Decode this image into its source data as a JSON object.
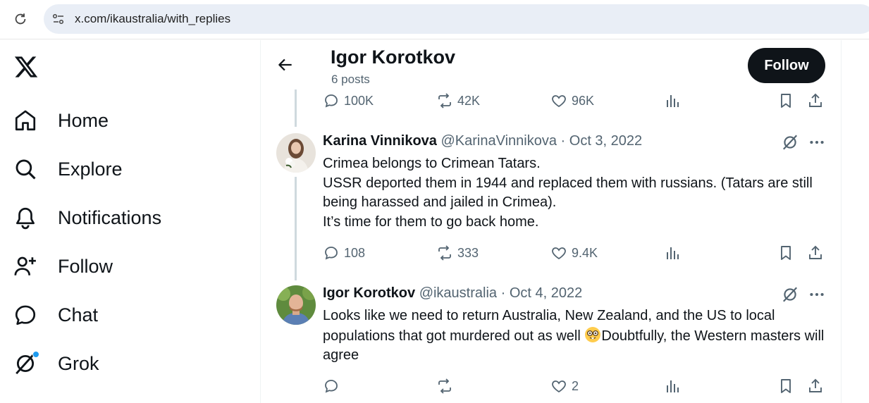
{
  "browser": {
    "url": "x.com/ikaustralia/with_replies"
  },
  "nav": {
    "items": [
      {
        "label": "Home",
        "icon": "home-icon"
      },
      {
        "label": "Explore",
        "icon": "search-icon"
      },
      {
        "label": "Notifications",
        "icon": "bell-icon"
      },
      {
        "label": "Follow",
        "icon": "person-add-icon"
      },
      {
        "label": "Chat",
        "icon": "chat-bubble-icon"
      },
      {
        "label": "Grok",
        "icon": "grok-icon"
      }
    ]
  },
  "header": {
    "name": "Igor Korotkov",
    "posts": "6 posts",
    "follow_label": "Follow"
  },
  "prev_tweet": {
    "replies": "100K",
    "reposts": "42K",
    "likes": "96K"
  },
  "tweets": [
    {
      "name": "Karina Vinnikova",
      "handle": "@KarinaVinnikova",
      "sep": "·",
      "date": "Oct 3, 2022",
      "lines": [
        "Crimea belongs to Crimean Tatars.",
        "USSR deported them in 1944 and replaced them with russians. (Tatars are still being harassed and jailed in Crimea).",
        "It’s time for them to go back home."
      ],
      "replies": "108",
      "reposts": "333",
      "likes": "9.4K"
    },
    {
      "name": "Igor Korotkov",
      "handle": "@ikaustralia",
      "sep": "·",
      "date": "Oct 4, 2022",
      "text_a": "Looks like we need to return Australia, New Zealand, and the US to local populations that got murdered out as well ",
      "emoji": "nerd-face",
      "text_b": "Doubtfully, the Western masters will agree",
      "replies": "",
      "reposts": "",
      "likes": "2"
    }
  ],
  "colors": {
    "accent": "#1d9bf0",
    "text": "#0f1419",
    "muted": "#536471",
    "button": "#0f1419"
  }
}
